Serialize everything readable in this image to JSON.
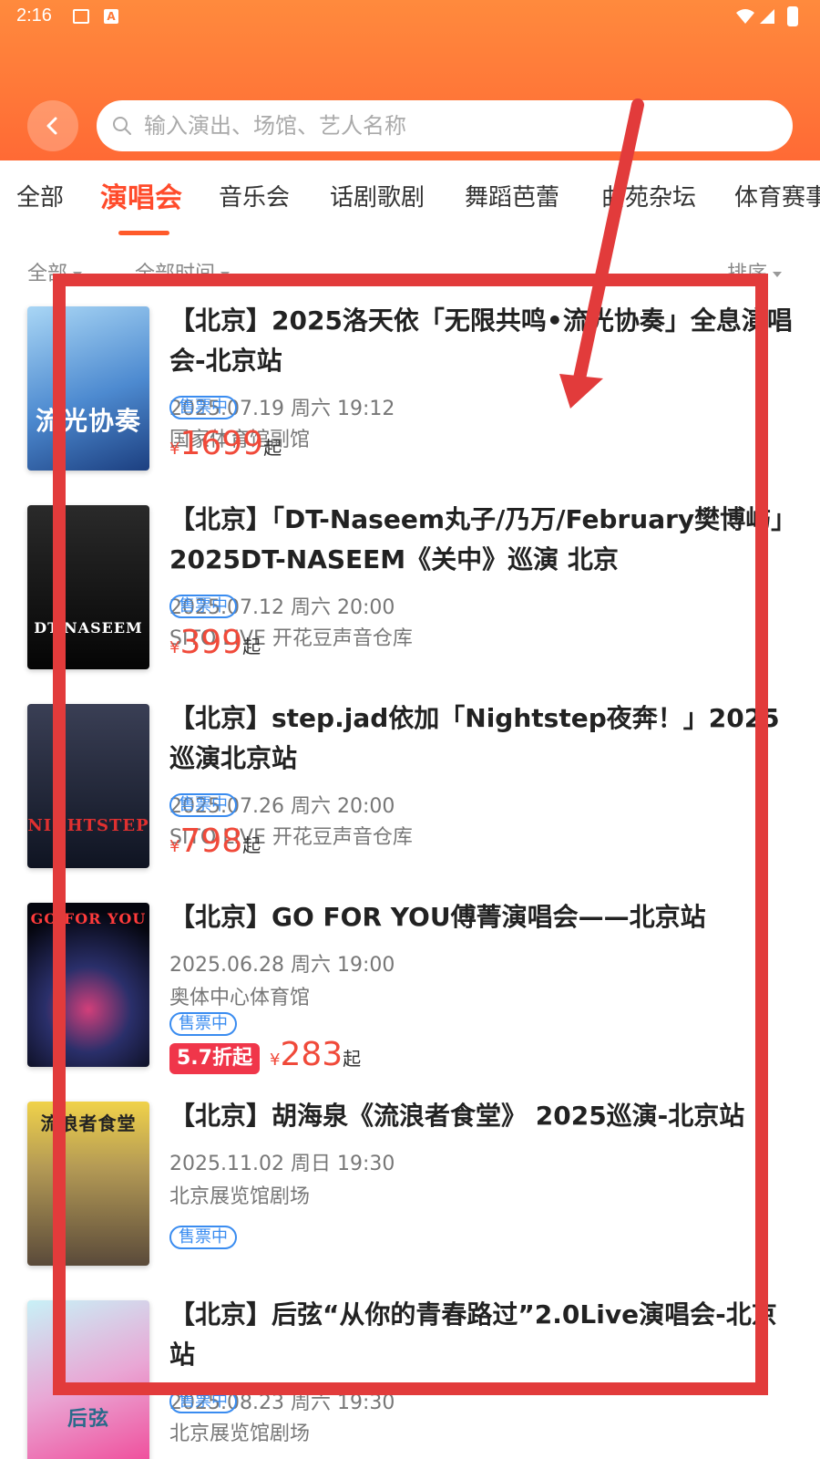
{
  "status_bar": {
    "time": "2:16",
    "a_icon": "A"
  },
  "search": {
    "placeholder": "输入演出、场馆、艺人名称"
  },
  "tabs": [
    {
      "label": "全部"
    },
    {
      "label": "演唱会"
    },
    {
      "label": "音乐会"
    },
    {
      "label": "话剧歌剧"
    },
    {
      "label": "舞蹈芭蕾"
    },
    {
      "label": "曲苑杂坛"
    },
    {
      "label": "体育赛事"
    }
  ],
  "filters": {
    "category": "全部",
    "time": "全部时间",
    "sort": "排序"
  },
  "shows": [
    {
      "title": "【北京】2025洛天依「无限共鸣•流光协奏」全息演唱会-北京站",
      "date": "2025.07.19 周六 19:12",
      "venue": "国家体育馆副馆",
      "status": "售票中",
      "yen": "¥",
      "price": "1699",
      "price_suffix": "起",
      "poster_text": "流光协奏",
      "poster_colors": [
        "#7fb6e6",
        "#2a5ea8"
      ]
    },
    {
      "title": "【北京】「DT-Naseem丸子/乃万/February樊博屿」2025DT-NASEEM《关中》巡演 北京",
      "date": "2025.07.12 周六 20:00",
      "venue": "SITO LIVE 开花豆声音仓库",
      "status": "售票中",
      "yen": "¥",
      "price": "399",
      "price_suffix": "起",
      "poster_text": "DT-NASEEM",
      "poster_colors": [
        "#1b1b1b",
        "#000000"
      ]
    },
    {
      "title": "【北京】step.jad依加「Nightstep夜奔！」2025巡演北京站",
      "date": "2025.07.26 周六 20:00",
      "venue": "SITO LIVE 开花豆声音仓库",
      "status": "售票中",
      "yen": "¥",
      "price": "798",
      "price_suffix": "起",
      "poster_text": "NIGHTSTEP",
      "poster_colors": [
        "#2b2f3f",
        "#0e1220"
      ]
    },
    {
      "title": "【北京】GO FOR YOU傅菁演唱会——北京站",
      "date": "2025.06.28 周六 19:00",
      "venue": "奥体中心体育馆",
      "status": "售票中",
      "discount": "5.7折起",
      "yen": "¥",
      "price": "283",
      "price_suffix": "起",
      "poster_text": "GO FOR YOU",
      "poster_colors": [
        "#1b1f3b",
        "#05060f"
      ]
    },
    {
      "title": "【北京】胡海泉《流浪者食堂》 2025巡演-北京站",
      "date": "2025.11.02 周日 19:30",
      "venue": "北京展览馆剧场",
      "status": "售票中",
      "poster_text": "流浪者食堂",
      "poster_colors": [
        "#e8c84a",
        "#6a5a3a"
      ]
    },
    {
      "title": "【北京】后弦“从你的青春路过”2.0Live演唱会-北京站",
      "date": "2025.08.23 周六 19:30",
      "venue": "北京展览馆剧场",
      "status": "售票中",
      "poster_text": "后弦",
      "poster_colors": [
        "#bfe9f0",
        "#f25aa0"
      ]
    }
  ],
  "colors": {
    "header_start": "#ff8a3d",
    "header_end": "#ff6a35",
    "accent": "#ff4b2b",
    "price": "#f04a3a",
    "status_blue": "#3a8cf0",
    "annotation_red": "#e23b3b"
  }
}
